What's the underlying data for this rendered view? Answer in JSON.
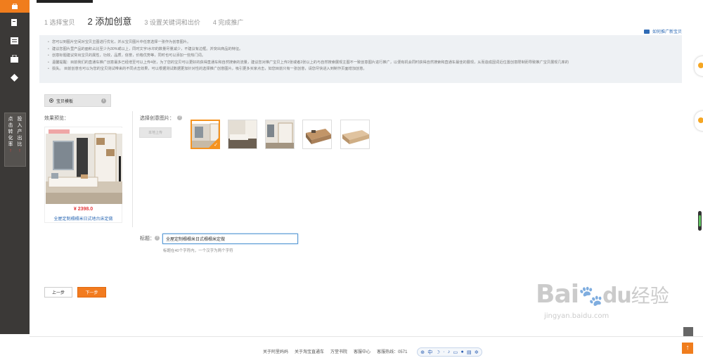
{
  "steps": [
    {
      "label": "1 选择宝贝",
      "current": false
    },
    {
      "label": "2 添加创意",
      "current": true
    },
    {
      "label": "3 设置关键词和出价",
      "current": false
    },
    {
      "label": "4 完成推广",
      "current": false
    }
  ],
  "howto_link": "如何推广新宝贝",
  "hints": [
    "您可以到图片空间对宝贝主图进行优化，并从宝贝图片中任意选择一张作为创意图片。",
    "建议您图片里产品的面积占比至少为30%或以上，同时文字/水印的数量尽量减少，不建议有边框。并突出商品的特征。",
    "创意标题建议突出宝贝的属性，功效，品质，信誉，价格优势等，同时也可以添加一些热门词。",
    "温馨提醒：目前我们的直通车推广创意最多已经增至可以上传4张，为了您的宝贝可以更好的获得直通车和自然搜索的流量，建议您对推广宝贝上传2张或者2张以上的与自然搜索展现主图不一致创意图片进行推广，以便有机会同时获得自然搜索和直通车最佳的展现，从而造成因词近位置创意限制而导致推广宝贝展现几率的",
    "损失。 目前创意也可以为您的宝贝测试带来的不同点击效果，可以根据测试数据更加针对性的选择推广创意图片，吸引更多买家点击，如您目前只有一张创意，请您尽快进入到制作页面增加创意。"
  ],
  "template_tab": "宝贝模板",
  "preview_label": "效果预览：",
  "preview": {
    "price": "¥ 2398.0",
    "title": "全屋定制榻榻米日式地台床定做"
  },
  "choose_label": "选择创意图片：",
  "local_upload": "本地上传",
  "thumbnails": [
    {
      "name": "creative-image-1",
      "selected": true
    },
    {
      "name": "creative-image-2",
      "selected": false
    },
    {
      "name": "creative-image-3",
      "selected": false
    },
    {
      "name": "creative-image-4",
      "selected": false
    },
    {
      "name": "creative-image-5",
      "selected": false
    }
  ],
  "title_field": {
    "label": "标题：",
    "value": "全屋定制榻榻米日式榻榻米定做",
    "tip": "标题在40个字符内，一个汉字为两个字符"
  },
  "buttons": {
    "prev": "上一步",
    "next": "下一步"
  },
  "sidebar_promo": {
    "col1": "点击转化率",
    "col2": "投入产出比"
  },
  "footer": {
    "links": [
      "关于阿里妈妈",
      "关于淘宝直通车",
      "万堂书院",
      "客服中心",
      "客服热线：0571"
    ]
  },
  "ime": {
    "lang": "中"
  },
  "watermark": {
    "brand": "Bai",
    "cn": "经验",
    "url": "jingyan.baidu.com"
  },
  "colors": {
    "accent": "#f27b1f",
    "sidebar": "#3b3937",
    "link": "#2f6bb5",
    "price": "#e4393c"
  }
}
